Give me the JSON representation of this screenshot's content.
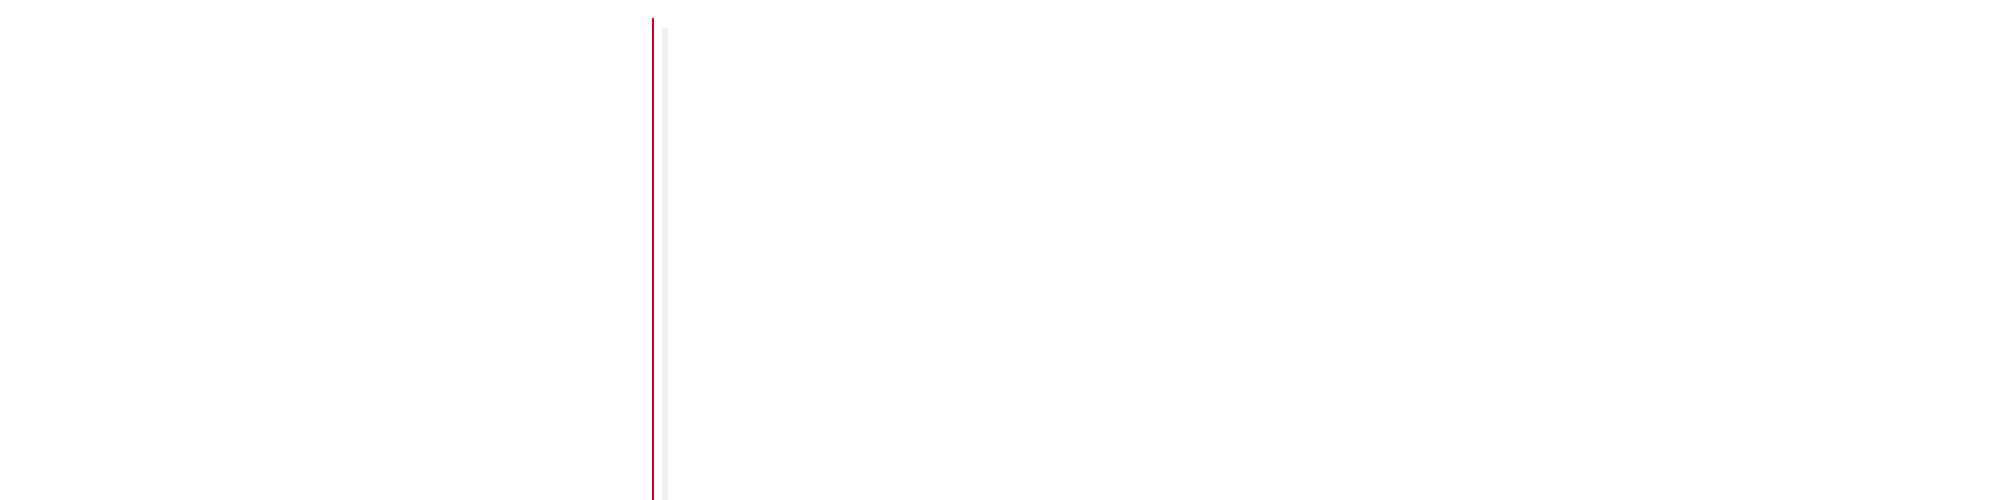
{
  "panes": {
    "left_label": "",
    "right_label": ""
  },
  "divider": {
    "color": "#d0021b",
    "shadow_color": "#efefef"
  },
  "colors": {
    "background": "#ffffff"
  }
}
